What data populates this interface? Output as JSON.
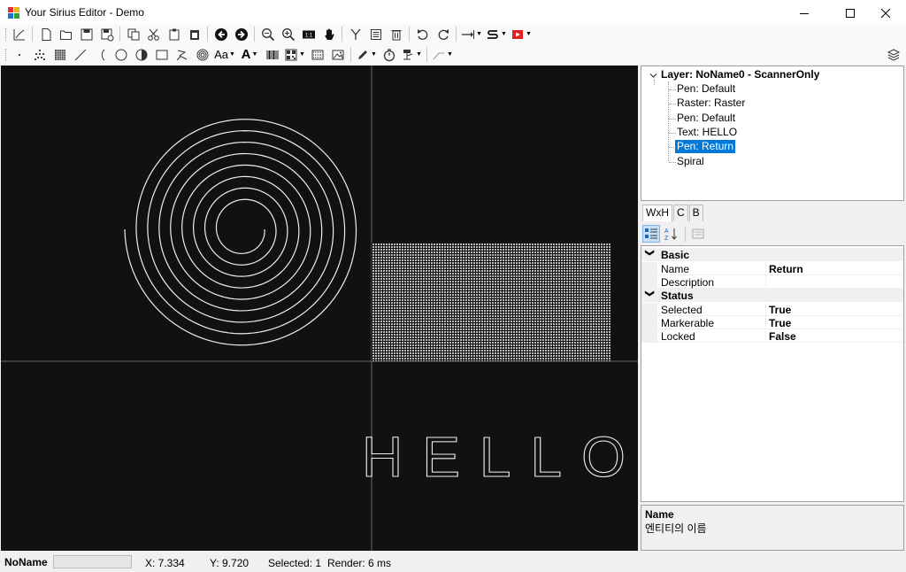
{
  "window": {
    "title": "Your Sirius Editor - Demo"
  },
  "toolbar2": {
    "font_label": "Aa",
    "text_label": "A"
  },
  "tree": {
    "root": "Layer: NoName0 - ScannerOnly",
    "items": [
      {
        "label": "Pen: Default",
        "selected": false
      },
      {
        "label": "Raster: Raster",
        "selected": false
      },
      {
        "label": "Pen: Default",
        "selected": false
      },
      {
        "label": "Text: HELLO",
        "selected": false
      },
      {
        "label": "Pen: Return",
        "selected": true
      },
      {
        "label": "Spiral",
        "selected": false
      }
    ]
  },
  "tabs": [
    "WxH",
    "C",
    "B"
  ],
  "propgrid": {
    "categories": [
      {
        "name": "Basic",
        "rows": [
          {
            "name": "Name",
            "value": "Return"
          },
          {
            "name": "Description",
            "value": ""
          }
        ]
      },
      {
        "name": "Status",
        "rows": [
          {
            "name": "Selected",
            "value": "True"
          },
          {
            "name": "Markerable",
            "value": "True"
          },
          {
            "name": "Locked",
            "value": "False"
          }
        ]
      }
    ]
  },
  "help": {
    "title": "Name",
    "description": "엔티티의 이름"
  },
  "canvas": {
    "text_entity": "HELLO"
  },
  "status": {
    "name": "NoName",
    "progress": 0,
    "x": "X: 7.334",
    "y": "Y: 9.720",
    "selected": "Selected: 1",
    "render": "Render: 6 ms"
  }
}
